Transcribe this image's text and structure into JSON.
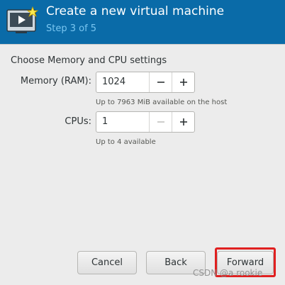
{
  "header": {
    "title": "Create a new virtual machine",
    "step": "Step 3 of 5",
    "icon": "virtual-machine-icon"
  },
  "section_title": "Choose Memory and CPU settings",
  "memory": {
    "label": "Memory (RAM):",
    "value": "1024",
    "hint": "Up to 7963 MiB available on the host"
  },
  "cpus": {
    "label": "CPUs:",
    "value": "1",
    "hint": "Up to 4 available",
    "decrement_disabled": true
  },
  "buttons": {
    "cancel": "Cancel",
    "back": "Back",
    "forward": "Forward"
  },
  "watermark": "CSDN @a rookie",
  "colors": {
    "header_bg": "#0a6ba8",
    "step_text": "#79c6f1",
    "highlight": "#e02020"
  }
}
